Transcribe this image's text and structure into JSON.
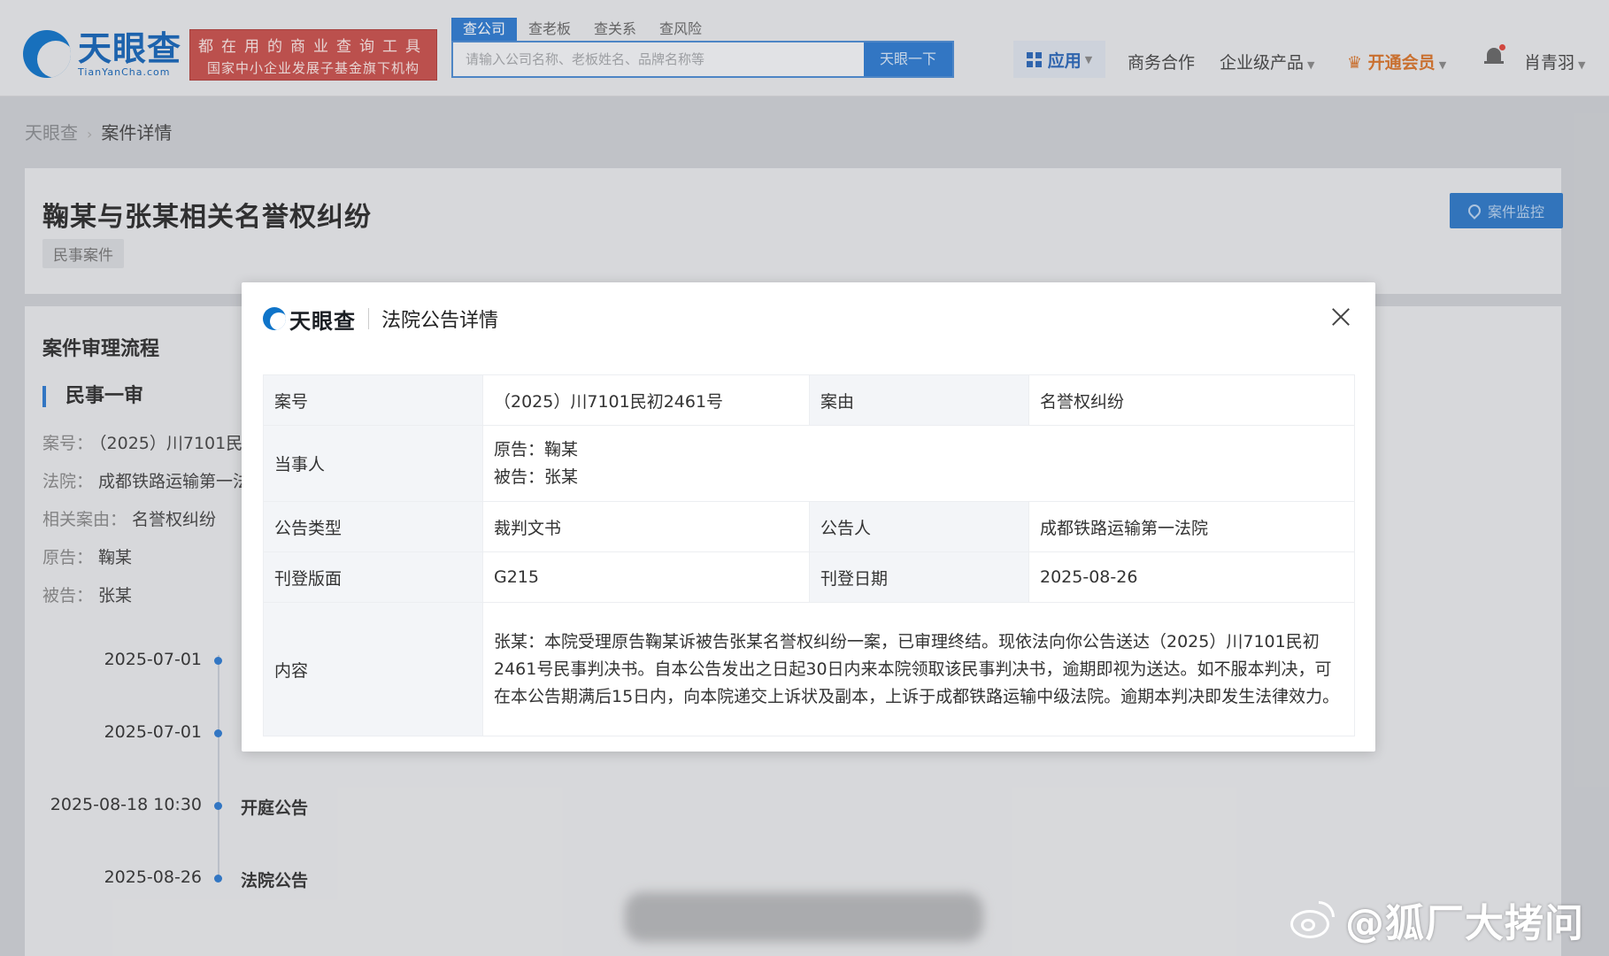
{
  "header": {
    "logo_cn": "天眼查",
    "logo_en": "TianYanCha.com",
    "slogan_line1": "都在用的商业查询工具",
    "slogan_line2": "国家中小企业发展子基金旗下机构",
    "search_tabs": [
      "查公司",
      "查老板",
      "查关系",
      "查风险"
    ],
    "search_placeholder": "请输入公司名称、老板姓名、品牌名称等",
    "search_button": "天眼一下",
    "nav_apps": "应用",
    "nav_business": "商务合作",
    "nav_enterprise": "企业级产品",
    "nav_vip": "开通会员",
    "user_name": "肖青羽",
    "colors": {
      "brand": "#1565b8",
      "accent": "#2d7ad1",
      "slogan_bg": "#c94f4a",
      "vip": "#d9742a"
    }
  },
  "breadcrumb": {
    "home": "天眼查",
    "current": "案件详情"
  },
  "case": {
    "title": "鞠某与张某相关名誉权纠纷",
    "tag": "民事案件",
    "monitor_button": "案件监控"
  },
  "process": {
    "title": "案件审理流程",
    "stage": "民事一审",
    "case_no_label": "案号：",
    "case_no_value": "（2025）川7101民",
    "court_label": "法院：",
    "court_value": "成都铁路运输第一法",
    "cause_label": "相关案由：",
    "cause_value": "名誉权纠纷",
    "plaintiff_label": "原告：",
    "plaintiff_value": "鞠某",
    "defendant_label": "被告：",
    "defendant_value": "张某",
    "timeline": [
      {
        "date": "2025-07-01",
        "label": ""
      },
      {
        "date": "2025-07-01",
        "label": ""
      },
      {
        "date": "2025-08-18 10:30",
        "label": "开庭公告"
      },
      {
        "date": "2025-08-26",
        "label": "法院公告"
      }
    ]
  },
  "modal": {
    "logo": "天眼查",
    "title": "法院公告详情",
    "rows": {
      "case_no_label": "案号",
      "case_no": "（2025）川7101民初2461号",
      "cause_label": "案由",
      "cause": "名誉权纠纷",
      "parties_label": "当事人",
      "plaintiff": "原告：鞠某",
      "defendant": "被告：张某",
      "type_label": "公告类型",
      "type": "裁判文书",
      "announcer_label": "公告人",
      "announcer": "成都铁路运输第一法院",
      "page_label": "刊登版面",
      "page": "G215",
      "date_label": "刊登日期",
      "date": "2025-08-26",
      "content_label": "内容",
      "content": "张某：本院受理原告鞠某诉被告张某名誉权纠纷一案，已审理终结。现依法向你公告送达（2025）川7101民初2461号民事判决书。自本公告发出之日起30日内来本院领取该民事判决书，逾期即视为送达。如不服本判决，可在本公告期满后15日内，向本院递交上诉状及副本，上诉于成都铁路运输中级法院。逾期本判决即发生法律效力。"
    }
  },
  "watermark": {
    "text": "@狐厂大拷问"
  }
}
